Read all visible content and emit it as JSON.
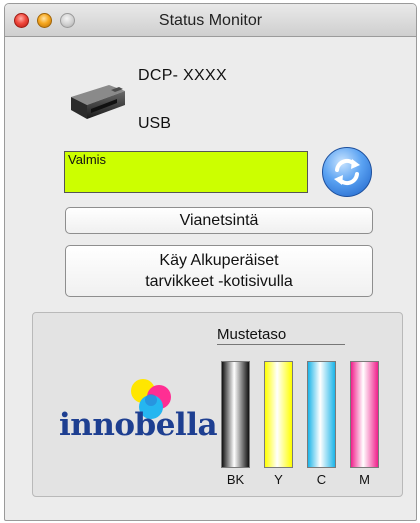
{
  "window": {
    "title": "Status Monitor"
  },
  "printer": {
    "model": "DCP- XXXX",
    "connection": "USB"
  },
  "status": {
    "text": "Valmis",
    "color": "#ccff00"
  },
  "buttons": {
    "troubleshooting": "Vianetsintä",
    "supplies_line1": "Käy Alkuperäiset",
    "supplies_line2": "tarvikkeet -kotisivulla"
  },
  "ink": {
    "heading": "Mustetaso",
    "tanks": [
      {
        "label": "BK",
        "color": "#111111",
        "level": 1.0
      },
      {
        "label": "Y",
        "color": "#ffff00",
        "level": 1.0
      },
      {
        "label": "C",
        "color": "#1cb4e8",
        "level": 1.0
      },
      {
        "label": "M",
        "color": "#f0208c",
        "level": 1.0
      }
    ]
  },
  "logo": {
    "text": "innobella"
  },
  "icons": {
    "printer": "printer-icon",
    "refresh": "refresh-icon"
  }
}
